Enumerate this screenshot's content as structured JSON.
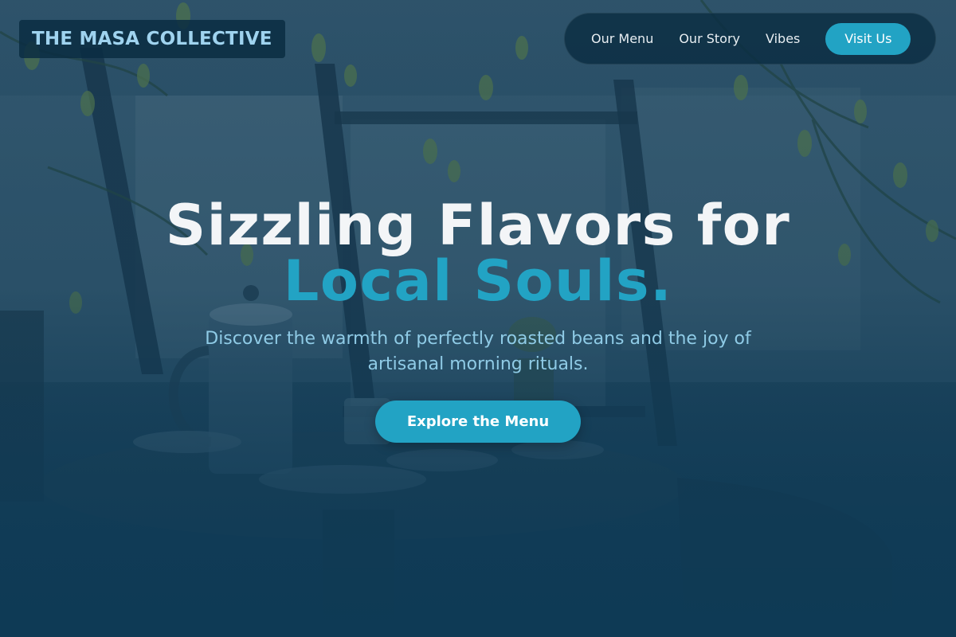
{
  "brand": {
    "name": "THE MASA COLLECTIVE"
  },
  "nav": {
    "links": [
      {
        "label": "Our Menu"
      },
      {
        "label": "Our Story"
      },
      {
        "label": "Vibes"
      }
    ],
    "cta_label": "Visit Us"
  },
  "hero": {
    "headline_line1": "Sizzling Flavors for",
    "headline_line2": "Local Souls.",
    "subtitle": "Discover the warmth of perfectly roasted beans and the joy of artisanal morning rituals.",
    "cta_label": "Explore the Menu",
    "background_image": "cafe-table-french-press-photo"
  },
  "colors": {
    "accent": "#22a3c4",
    "navy": "#0e3a55",
    "brand_text": "#9fd3ef",
    "subtitle_text": "#8fcbe6",
    "headline_text": "#f3f5f7"
  }
}
